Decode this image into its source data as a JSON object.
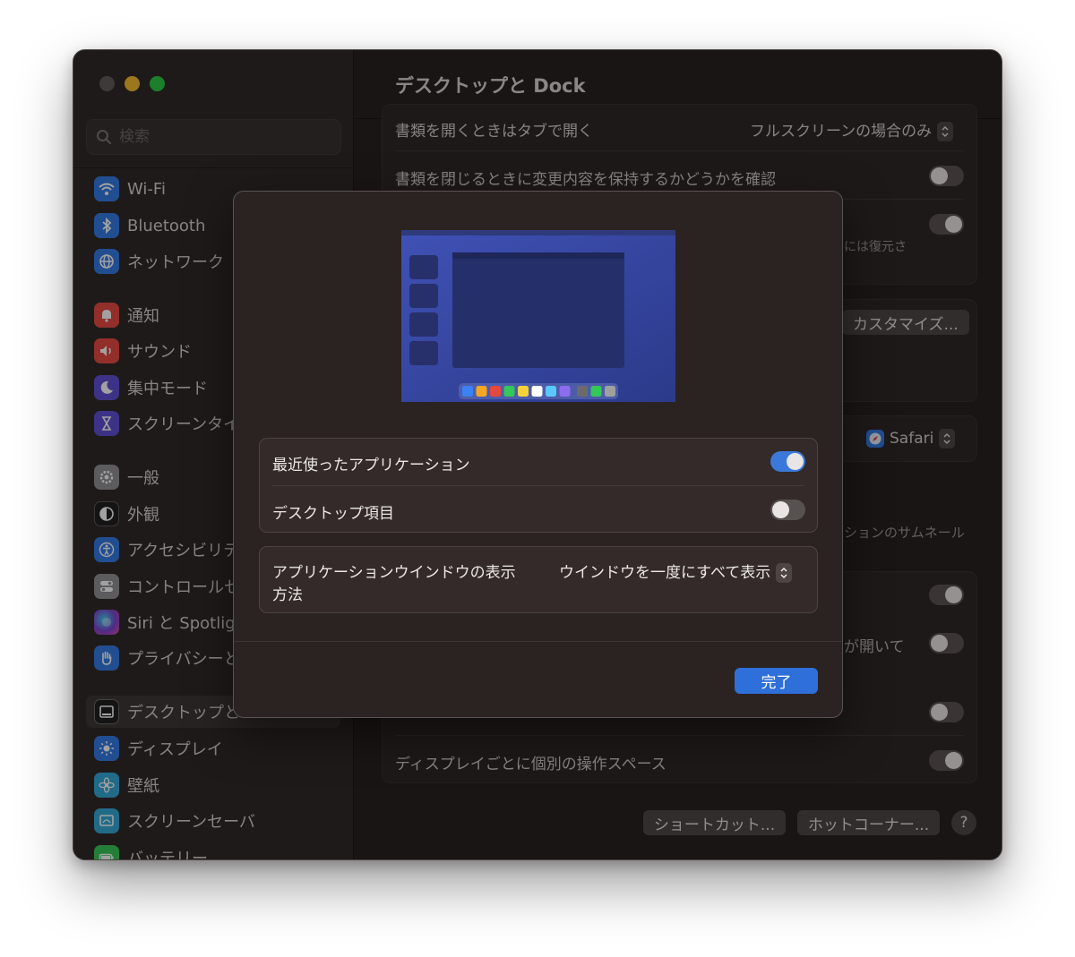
{
  "window": {
    "title": "デスクトップと Dock"
  },
  "search": {
    "placeholder": "検索"
  },
  "sidebar": {
    "items": [
      {
        "label": "Wi-Fi",
        "icon": "wifi-icon",
        "color": "#2f7ae5"
      },
      {
        "label": "Bluetooth",
        "icon": "bluetooth-icon",
        "color": "#2f7ae5"
      },
      {
        "label": "ネットワーク",
        "icon": "globe-icon",
        "color": "#2f7ae5"
      },
      {
        "label": "通知",
        "icon": "bell-icon",
        "color": "#e5483f"
      },
      {
        "label": "サウンド",
        "icon": "speaker-icon",
        "color": "#e5483f"
      },
      {
        "label": "集中モード",
        "icon": "moon-icon",
        "color": "#5b4ed6"
      },
      {
        "label": "スクリーンタイ",
        "icon": "hourglass-icon",
        "color": "#5b4ed6"
      },
      {
        "label": "一般",
        "icon": "gear-icon",
        "color": "#8e8e93"
      },
      {
        "label": "外観",
        "icon": "appearance-icon",
        "color": "#1c1c1e"
      },
      {
        "label": "アクセシビリテ",
        "icon": "accessibility-icon",
        "color": "#2f7ae5"
      },
      {
        "label": "コントロールセ",
        "icon": "control-center-icon",
        "color": "#8e8e93"
      },
      {
        "label": "Siri と Spotligh",
        "icon": "siri-icon",
        "color": "#7a3fd0"
      },
      {
        "label": "プライバシーと",
        "icon": "hand-icon",
        "color": "#2f7ae5"
      },
      {
        "label": "デスクトップと",
        "icon": "dock-icon",
        "color": "#1c1c1e"
      },
      {
        "label": "ディスプレイ",
        "icon": "sun-icon",
        "color": "#2f7ae5"
      },
      {
        "label": "壁紙",
        "icon": "flower-icon",
        "color": "#2fa9d9"
      },
      {
        "label": "スクリーンセーバ",
        "icon": "screensaver-icon",
        "color": "#2fa9d9"
      },
      {
        "label": "バッテリー",
        "icon": "battery-icon",
        "color": "#34c759"
      }
    ]
  },
  "main": {
    "rows": {
      "open_in_tabs": {
        "label": "書類を開くときはタブで開く",
        "value": "フルスクリーンの場合のみ"
      },
      "ask_keep_changes": {
        "label": "書類を閉じるときに変更内容を保持するかどうかを確認"
      },
      "restore_note": "には復元さ",
      "customize_button": "カスタマイズ...",
      "default_browser": "Safari",
      "thumbnail_note": "ションのサムネール",
      "open_note": "が開いて",
      "separate_spaces": {
        "label": "ディスプレイごとに個別の操作スペース"
      }
    },
    "footer": {
      "shortcuts_button": "ショートカット...",
      "hot_corners_button": "ホットコーナー...",
      "help_button": "?"
    }
  },
  "sheet": {
    "recent_apps": {
      "label": "最近使ったアプリケーション",
      "on": true
    },
    "desktop_items": {
      "label": "デスクトップ項目",
      "on": false
    },
    "window_display": {
      "label_line1": "アプリケーションウインドウの表示",
      "label_line2": "方法",
      "value": "ウインドウを一度にすべて表示"
    },
    "done_button": "完了"
  },
  "colors": {
    "accent": "#2f6fd9",
    "toggle_on": "#3a78d9",
    "window_bg": "#221d1c",
    "sheet_bg": "#2b2322"
  },
  "dock_preview_colors": [
    "#3b82f6",
    "#f5a623",
    "#e5483f",
    "#34c759",
    "#f5d03b",
    "#ffffff",
    "#5ac8fa",
    "#8e6cf0",
    "#6b6b6b",
    "#34c759",
    "#a0a0a0"
  ]
}
